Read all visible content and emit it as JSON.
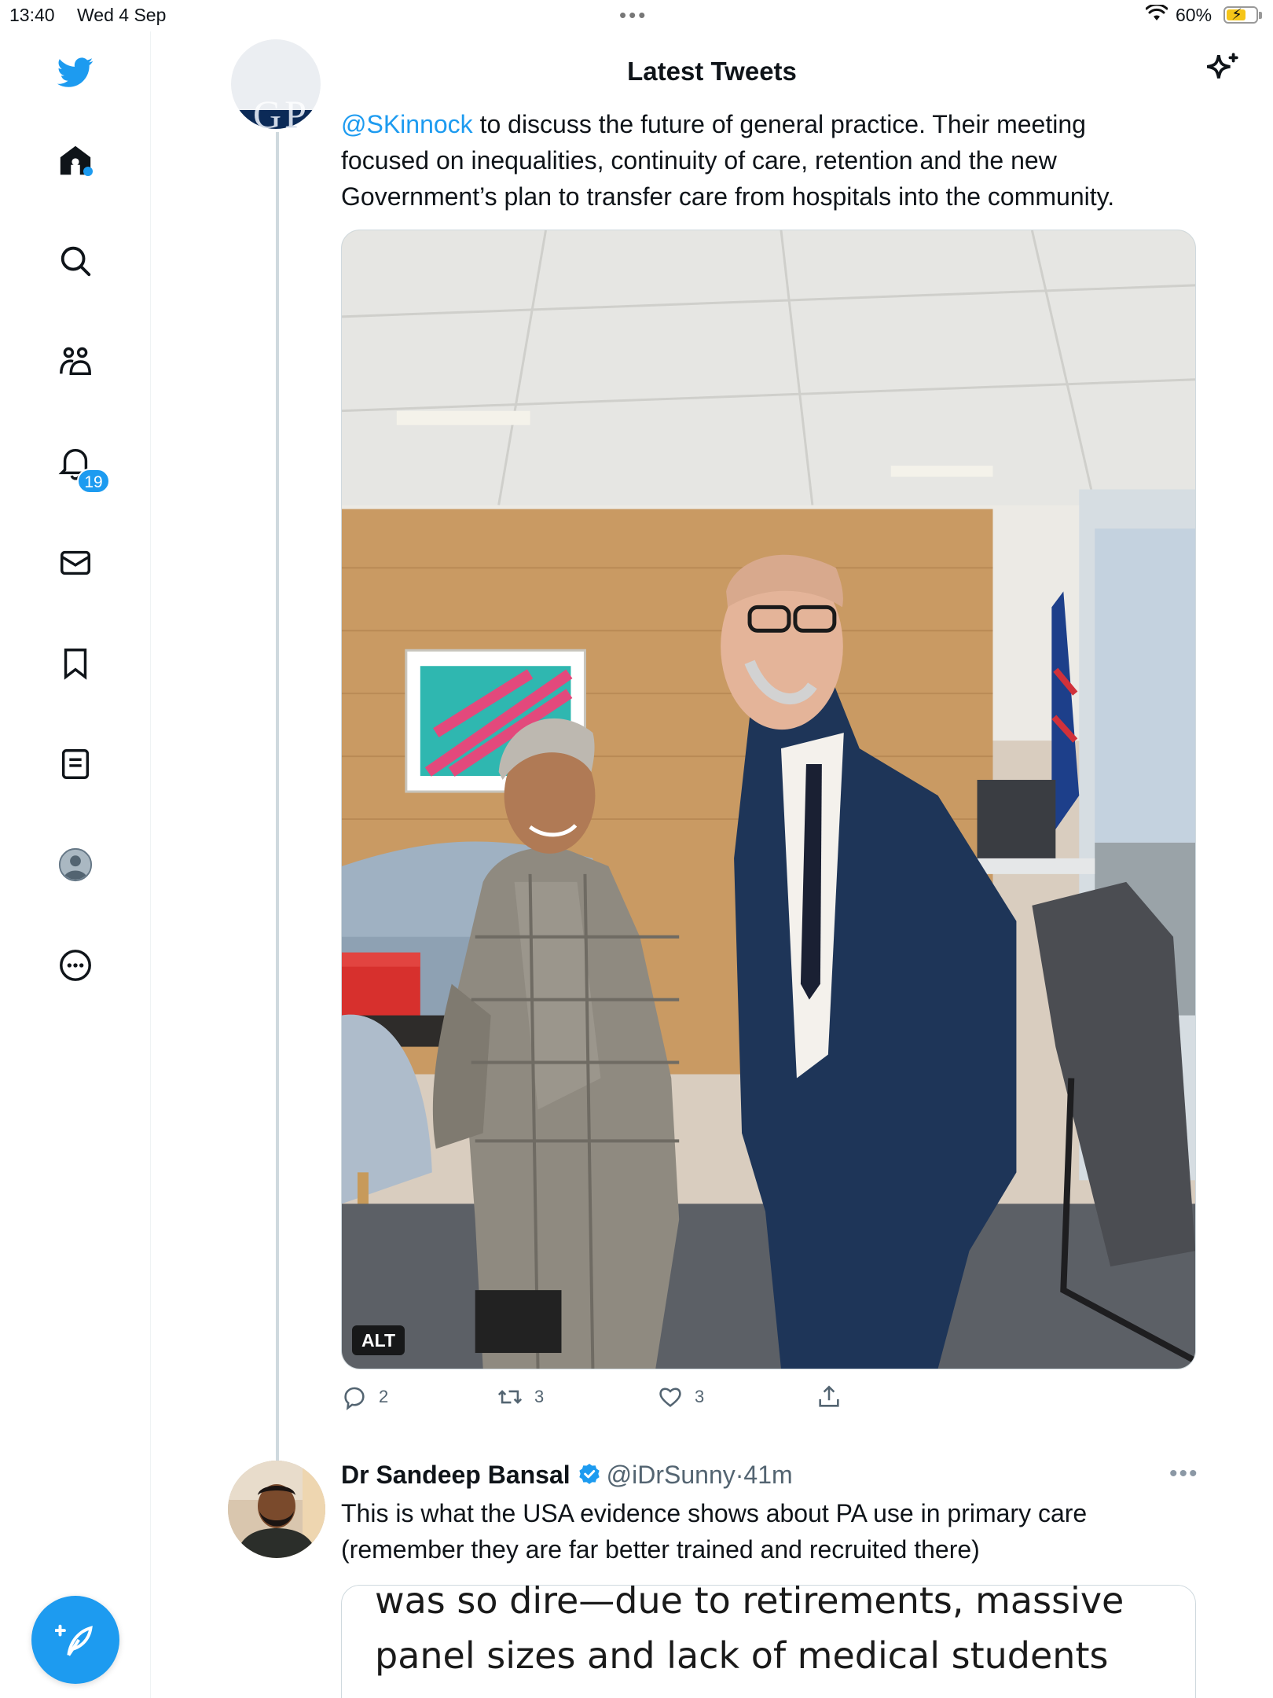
{
  "status_bar": {
    "time": "13:40",
    "date": "Wed 4 Sep",
    "battery": "60%"
  },
  "header": {
    "title": "Latest Tweets"
  },
  "sidebar": {
    "notifications_badge": "19",
    "items": [
      "home-icon",
      "search-icon",
      "communities-icon",
      "notifications-icon",
      "messages-icon",
      "bookmarks-icon",
      "lists-icon",
      "profile-avatar",
      "more-icon"
    ]
  },
  "tweet1": {
    "mention": "@SKinnock",
    "line1_rest": " to discuss the future of general practice. Their meeting",
    "line2": "focused on inequalities, continuity of care, retention and the new",
    "line3": "Government’s plan to transfer care from hospitals into the community.",
    "alt_label": "ALT",
    "replies": "2",
    "retweets": "3",
    "likes": "3"
  },
  "tweet2": {
    "name": "Dr Sandeep Bansal",
    "handle": "@iDrSunny",
    "separator": " · ",
    "time": "41m",
    "line1": "This is what the USA evidence shows about PA use in primary care",
    "line2": "(remember they are far better trained and recruited there)",
    "quote_line1": "was so dire—due to retirements, massive",
    "quote_line2": "panel sizes and lack of medical students"
  },
  "colors": {
    "accent": "#1d9bf0",
    "text": "#0f1419",
    "secondary": "#536471"
  }
}
